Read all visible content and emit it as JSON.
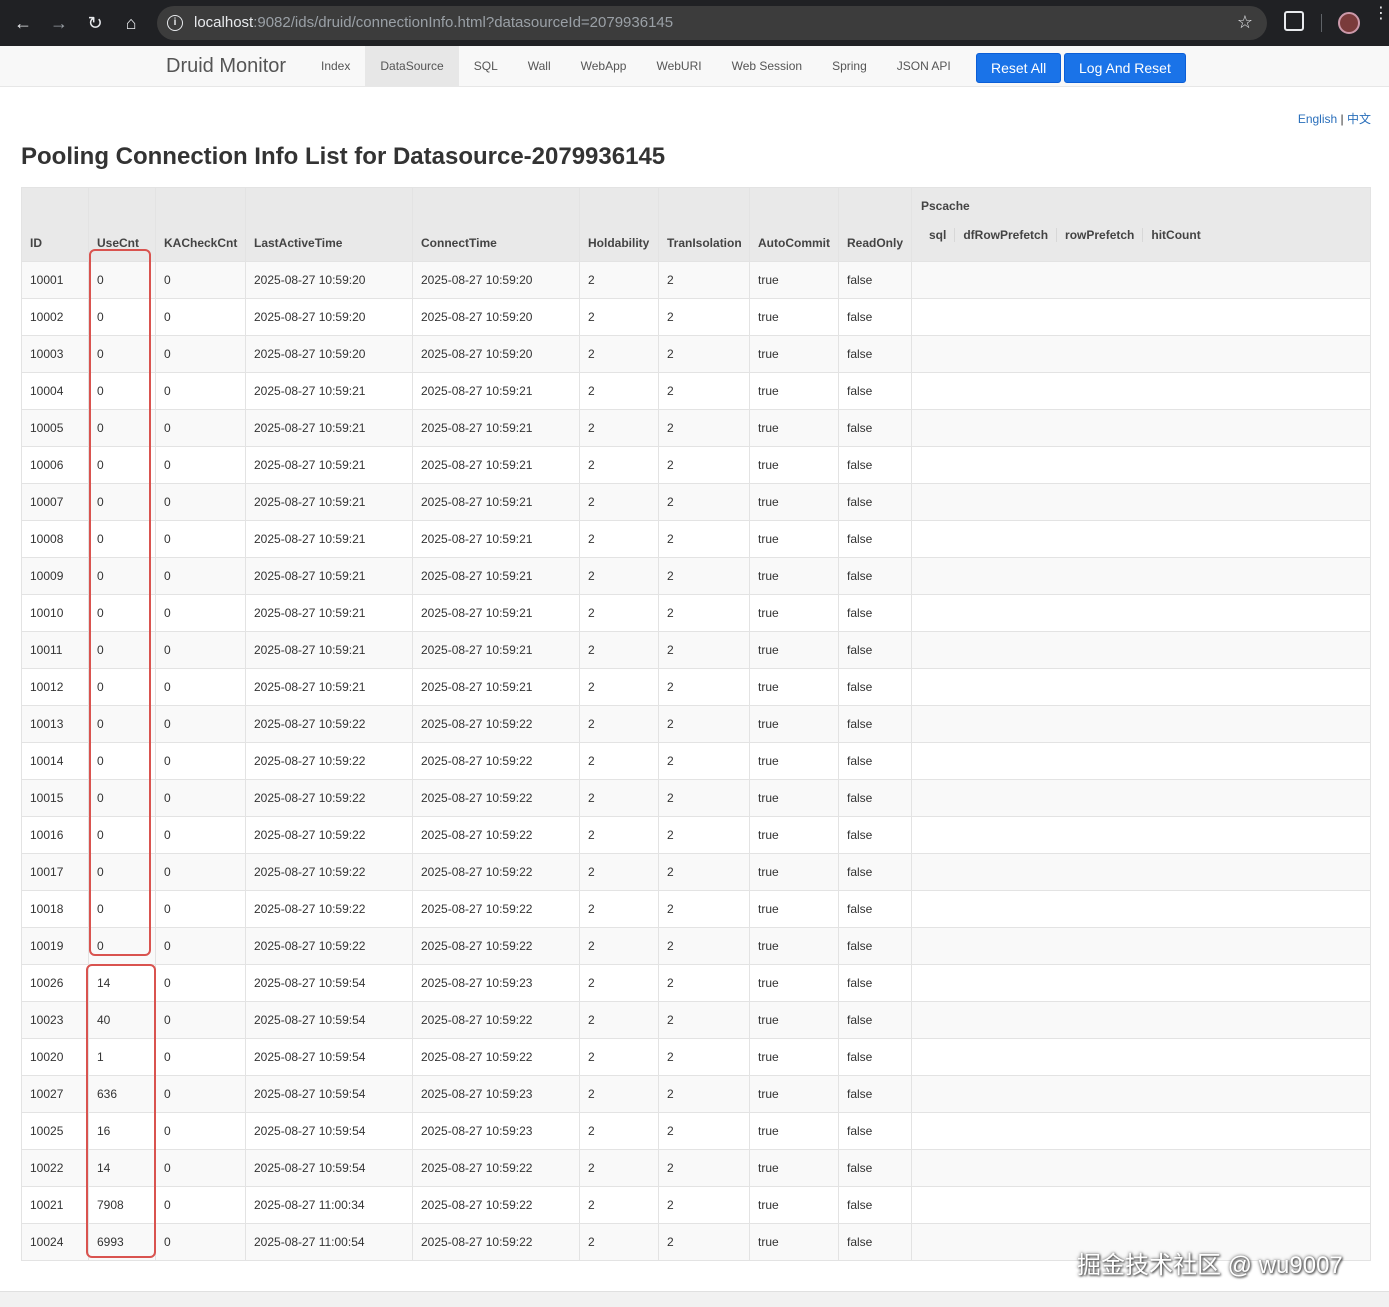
{
  "browser": {
    "url_host": "localhost",
    "url_rest": ":9082/ids/druid/connectionInfo.html?datasourceId=2079936145"
  },
  "navbar": {
    "brand": "Druid Monitor",
    "links": [
      "Index",
      "DataSource",
      "SQL",
      "Wall",
      "WebApp",
      "WebURI",
      "Web Session",
      "Spring",
      "JSON API"
    ],
    "active": "DataSource",
    "reset_all": "Reset All",
    "log_and_reset": "Log And Reset"
  },
  "lang": {
    "english": "English",
    "separator": "|",
    "chinese": "中文"
  },
  "page_title": "Pooling Connection Info List for Datasource-2079936145",
  "table": {
    "headers": [
      "ID",
      "UseCnt",
      "KACheckCnt",
      "LastActiveTime",
      "ConnectTime",
      "Holdability",
      "TranIsolation",
      "AutoCommit",
      "ReadOnly"
    ],
    "pscache_header": "Pscache",
    "pscache_sub": [
      "sql",
      "dfRowPrefetch",
      "rowPrefetch",
      "hitCount"
    ],
    "rows": [
      [
        "10001",
        "0",
        "0",
        "2025-08-27 10:59:20",
        "2025-08-27 10:59:20",
        "2",
        "2",
        "true",
        "false"
      ],
      [
        "10002",
        "0",
        "0",
        "2025-08-27 10:59:20",
        "2025-08-27 10:59:20",
        "2",
        "2",
        "true",
        "false"
      ],
      [
        "10003",
        "0",
        "0",
        "2025-08-27 10:59:20",
        "2025-08-27 10:59:20",
        "2",
        "2",
        "true",
        "false"
      ],
      [
        "10004",
        "0",
        "0",
        "2025-08-27 10:59:21",
        "2025-08-27 10:59:21",
        "2",
        "2",
        "true",
        "false"
      ],
      [
        "10005",
        "0",
        "0",
        "2025-08-27 10:59:21",
        "2025-08-27 10:59:21",
        "2",
        "2",
        "true",
        "false"
      ],
      [
        "10006",
        "0",
        "0",
        "2025-08-27 10:59:21",
        "2025-08-27 10:59:21",
        "2",
        "2",
        "true",
        "false"
      ],
      [
        "10007",
        "0",
        "0",
        "2025-08-27 10:59:21",
        "2025-08-27 10:59:21",
        "2",
        "2",
        "true",
        "false"
      ],
      [
        "10008",
        "0",
        "0",
        "2025-08-27 10:59:21",
        "2025-08-27 10:59:21",
        "2",
        "2",
        "true",
        "false"
      ],
      [
        "10009",
        "0",
        "0",
        "2025-08-27 10:59:21",
        "2025-08-27 10:59:21",
        "2",
        "2",
        "true",
        "false"
      ],
      [
        "10010",
        "0",
        "0",
        "2025-08-27 10:59:21",
        "2025-08-27 10:59:21",
        "2",
        "2",
        "true",
        "false"
      ],
      [
        "10011",
        "0",
        "0",
        "2025-08-27 10:59:21",
        "2025-08-27 10:59:21",
        "2",
        "2",
        "true",
        "false"
      ],
      [
        "10012",
        "0",
        "0",
        "2025-08-27 10:59:21",
        "2025-08-27 10:59:21",
        "2",
        "2",
        "true",
        "false"
      ],
      [
        "10013",
        "0",
        "0",
        "2025-08-27 10:59:22",
        "2025-08-27 10:59:22",
        "2",
        "2",
        "true",
        "false"
      ],
      [
        "10014",
        "0",
        "0",
        "2025-08-27 10:59:22",
        "2025-08-27 10:59:22",
        "2",
        "2",
        "true",
        "false"
      ],
      [
        "10015",
        "0",
        "0",
        "2025-08-27 10:59:22",
        "2025-08-27 10:59:22",
        "2",
        "2",
        "true",
        "false"
      ],
      [
        "10016",
        "0",
        "0",
        "2025-08-27 10:59:22",
        "2025-08-27 10:59:22",
        "2",
        "2",
        "true",
        "false"
      ],
      [
        "10017",
        "0",
        "0",
        "2025-08-27 10:59:22",
        "2025-08-27 10:59:22",
        "2",
        "2",
        "true",
        "false"
      ],
      [
        "10018",
        "0",
        "0",
        "2025-08-27 10:59:22",
        "2025-08-27 10:59:22",
        "2",
        "2",
        "true",
        "false"
      ],
      [
        "10019",
        "0",
        "0",
        "2025-08-27 10:59:22",
        "2025-08-27 10:59:22",
        "2",
        "2",
        "true",
        "false"
      ],
      [
        "10026",
        "14",
        "0",
        "2025-08-27 10:59:54",
        "2025-08-27 10:59:23",
        "2",
        "2",
        "true",
        "false"
      ],
      [
        "10023",
        "40",
        "0",
        "2025-08-27 10:59:54",
        "2025-08-27 10:59:22",
        "2",
        "2",
        "true",
        "false"
      ],
      [
        "10020",
        "1",
        "0",
        "2025-08-27 10:59:54",
        "2025-08-27 10:59:22",
        "2",
        "2",
        "true",
        "false"
      ],
      [
        "10027",
        "636",
        "0",
        "2025-08-27 10:59:54",
        "2025-08-27 10:59:23",
        "2",
        "2",
        "true",
        "false"
      ],
      [
        "10025",
        "16",
        "0",
        "2025-08-27 10:59:54",
        "2025-08-27 10:59:23",
        "2",
        "2",
        "true",
        "false"
      ],
      [
        "10022",
        "14",
        "0",
        "2025-08-27 10:59:54",
        "2025-08-27 10:59:22",
        "2",
        "2",
        "true",
        "false"
      ],
      [
        "10021",
        "7908",
        "0",
        "2025-08-27 11:00:34",
        "2025-08-27 10:59:22",
        "2",
        "2",
        "true",
        "false"
      ],
      [
        "10024",
        "6993",
        "0",
        "2025-08-27 11:00:54",
        "2025-08-27 10:59:22",
        "2",
        "2",
        "true",
        "false"
      ]
    ]
  },
  "watermark": "掘金技术社区 @ wu9007",
  "colors": {
    "highlight": "#d9534f",
    "button": "#1a73e8",
    "link": "#2a6fbb"
  },
  "icons": [
    "back-icon",
    "forward-icon",
    "reload-icon",
    "home-icon",
    "site-info-icon",
    "bookmark-star-icon",
    "extensions-icon",
    "profile-avatar",
    "menu-icon"
  ]
}
